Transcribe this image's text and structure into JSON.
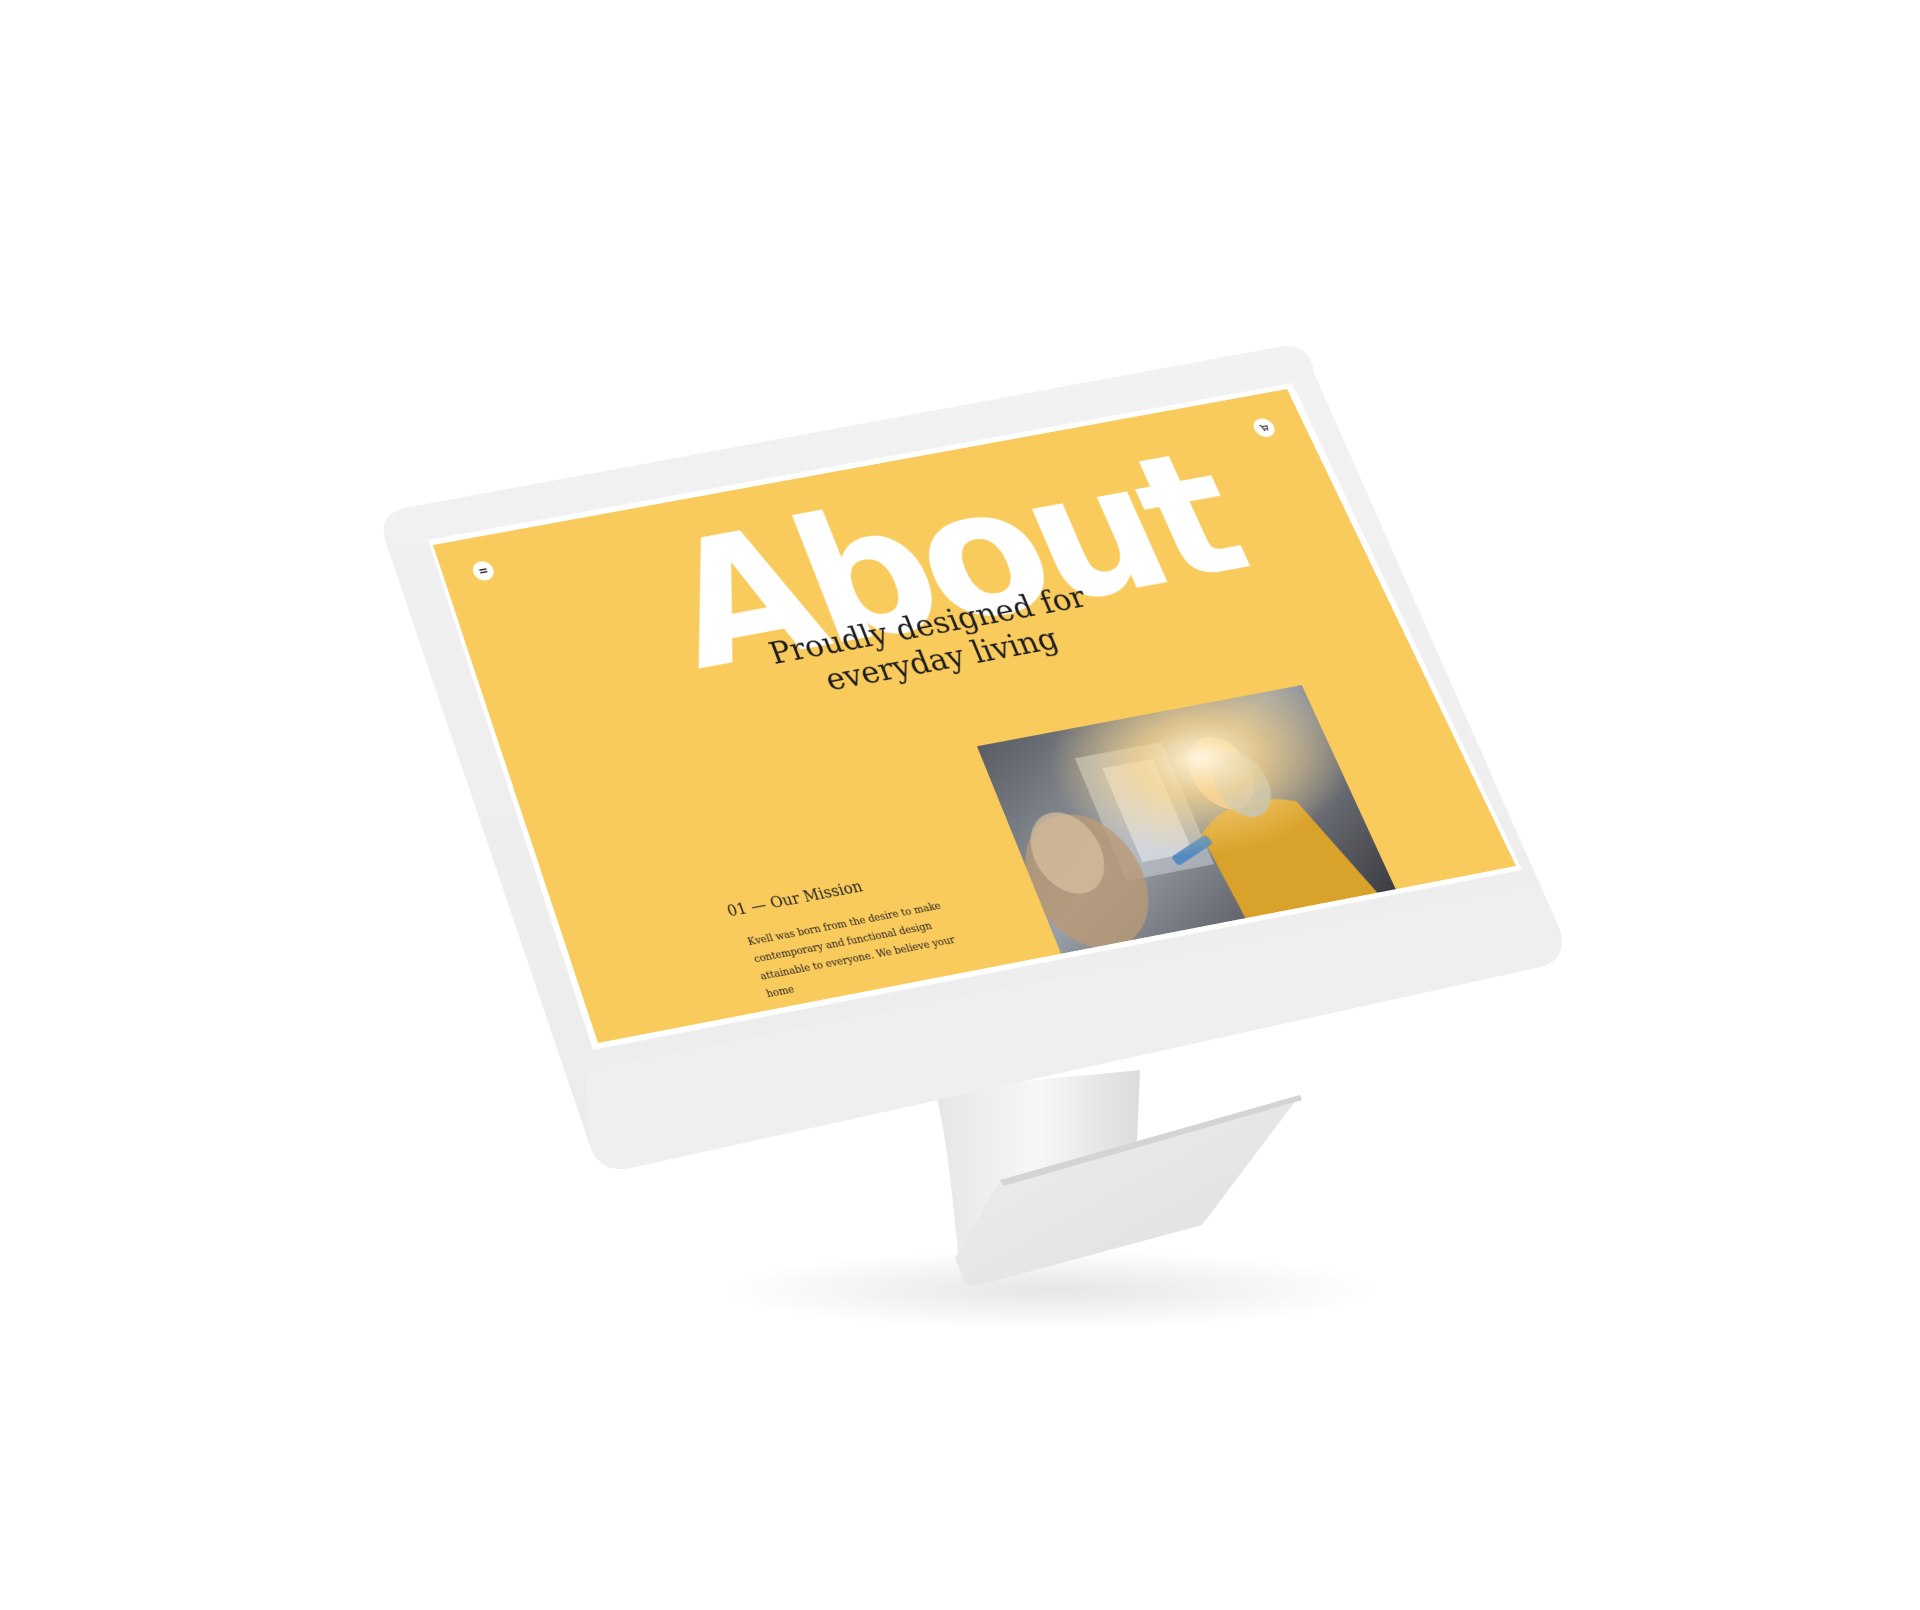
{
  "header": {
    "menu_icon": "menu-icon",
    "cart_icon": "cart-icon"
  },
  "hero": {
    "title": "About",
    "subtitle": "Proudly designed for everyday living"
  },
  "mission": {
    "label": "01 — Our Mission",
    "body": "Kvell was born from the desire to make contemporary and functional design attainable to everyone. We believe your home"
  },
  "colors": {
    "accent": "#f9cb5d",
    "text": "#1d1d1f",
    "bezel": "#f1f1f1"
  }
}
